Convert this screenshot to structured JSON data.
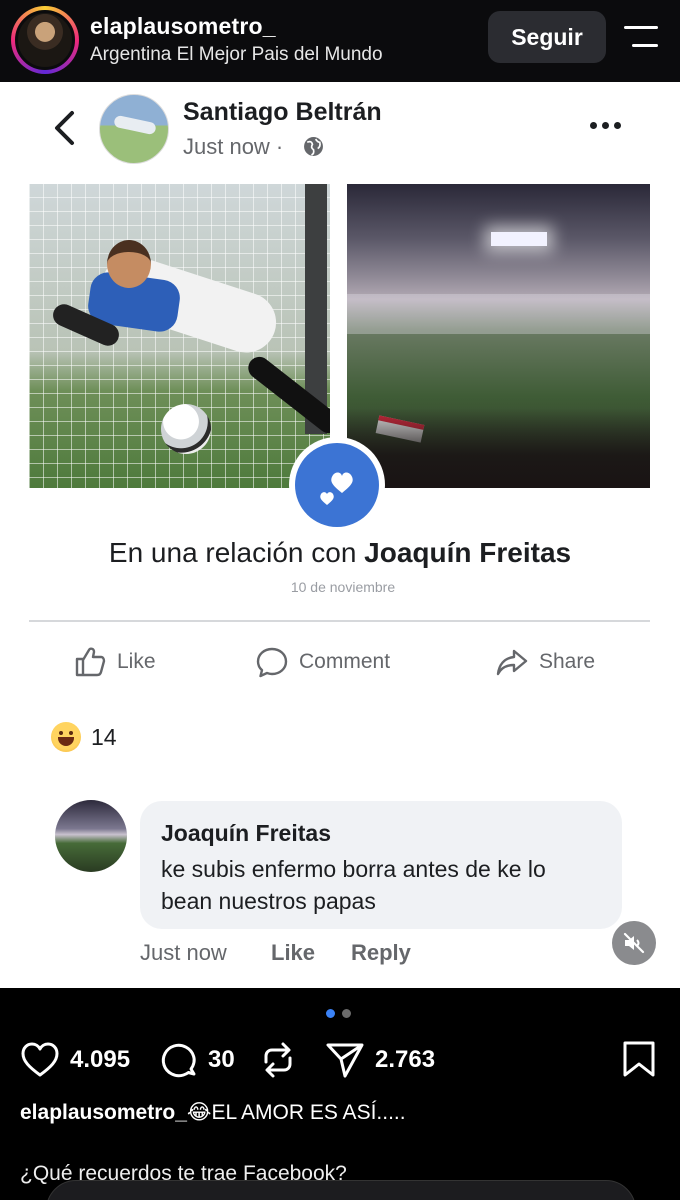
{
  "ig_header": {
    "username": "elaplausometro_",
    "subtitle": "Argentina El Mejor Pais del Mundo",
    "follow_label": "Seguir"
  },
  "fb_post": {
    "author": "Santiago Beltrán",
    "time": "Just now ·",
    "relationship_prefix": "En una relación con ",
    "relationship_partner": "Joaquín Freitas",
    "relationship_date": "10 de noviembre",
    "actions": {
      "like": "Like",
      "comment": "Comment",
      "share": "Share"
    },
    "reaction_count": "14",
    "comment": {
      "author": "Joaquín Freitas",
      "text": "ke subis enfermo borra antes de ke lo bean nuestros papas",
      "time": "Just now",
      "like": "Like",
      "reply": "Reply"
    }
  },
  "ig_footer": {
    "carousel": {
      "count": 2,
      "active": 0,
      "active_color": "#3b82f6",
      "inactive_color": "#6b6b6b"
    },
    "likes": "4.095",
    "comments": "30",
    "shares": "2.763",
    "caption_user": "elaplausometro_",
    "caption_emoji": "😂",
    "caption_text": "EL AMOR ES ASÍ.....",
    "caption_line2": "¿Qué recuerdos te trae Facebook?"
  },
  "colors": {
    "fb_blue": "#3c74d4",
    "fb_text": "#1c1e21",
    "fb_muted": "#65676b"
  }
}
